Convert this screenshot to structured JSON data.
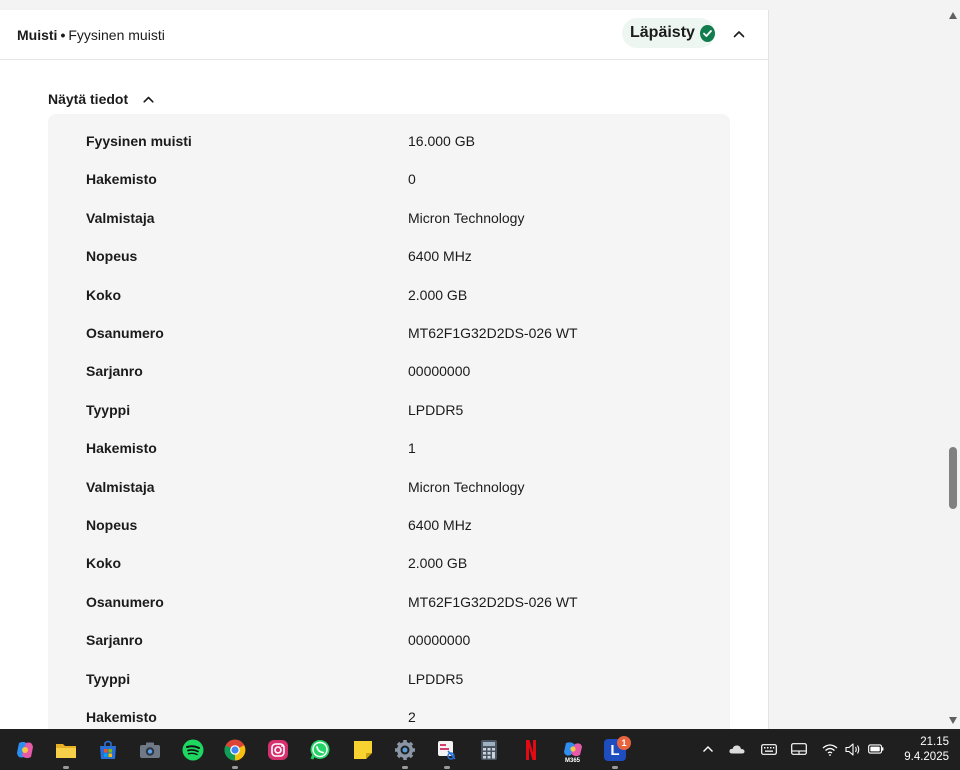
{
  "header": {
    "category": "Muisti",
    "separator": "•",
    "item": "Fyysinen muisti",
    "status_label": "Läpäisty",
    "status_color": "#117d4e"
  },
  "toggle": {
    "label": "Näytä tiedot"
  },
  "details": [
    {
      "key": "Fyysinen muisti",
      "value": "16.000 GB"
    },
    {
      "key": "Hakemisto",
      "value": "0"
    },
    {
      "key": "Valmistaja",
      "value": "Micron Technology"
    },
    {
      "key": "Nopeus",
      "value": "6400 MHz"
    },
    {
      "key": "Koko",
      "value": "2.000 GB"
    },
    {
      "key": "Osanumero",
      "value": "MT62F1G32D2DS-026 WT"
    },
    {
      "key": "Sarjanro",
      "value": "00000000"
    },
    {
      "key": "Tyyppi",
      "value": "LPDDR5"
    },
    {
      "key": "Hakemisto",
      "value": "1"
    },
    {
      "key": "Valmistaja",
      "value": "Micron Technology"
    },
    {
      "key": "Nopeus",
      "value": "6400 MHz"
    },
    {
      "key": "Koko",
      "value": "2.000 GB"
    },
    {
      "key": "Osanumero",
      "value": "MT62F1G32D2DS-026 WT"
    },
    {
      "key": "Sarjanro",
      "value": "00000000"
    },
    {
      "key": "Tyyppi",
      "value": "LPDDR5"
    },
    {
      "key": "Hakemisto",
      "value": "2"
    }
  ],
  "taskbar": {
    "apps": [
      "copilot-icon",
      "file-explorer-icon",
      "microsoft-store-icon",
      "camera-icon",
      "spotify-icon",
      "chrome-icon",
      "instagram-icon",
      "whatsapp-icon",
      "sticky-notes-icon",
      "settings-icon",
      "snipping-tool-icon",
      "calculator-icon",
      "netflix-icon",
      "m365-icon",
      "l-app-icon"
    ],
    "m365_label": "M365",
    "l_app_label": "L",
    "notification_count": "1",
    "time": "21.15",
    "date": "9.4.2025"
  }
}
